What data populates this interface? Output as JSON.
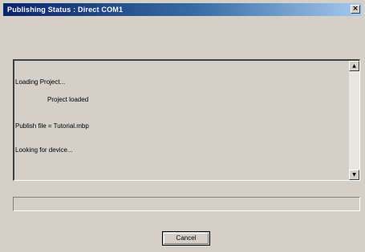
{
  "window": {
    "title": "Publishing Status : Direct COM1",
    "close_glyph": "×"
  },
  "log": {
    "lines": [
      "Loading Project...",
      "Project loaded",
      "Publish file = Tutorial.mbp",
      "Looking for device..."
    ]
  },
  "scrollbar": {
    "up_glyph": "▲",
    "down_glyph": "▼"
  },
  "progress": {
    "fraction": 0
  },
  "buttons": {
    "cancel_label": "Cancel"
  }
}
